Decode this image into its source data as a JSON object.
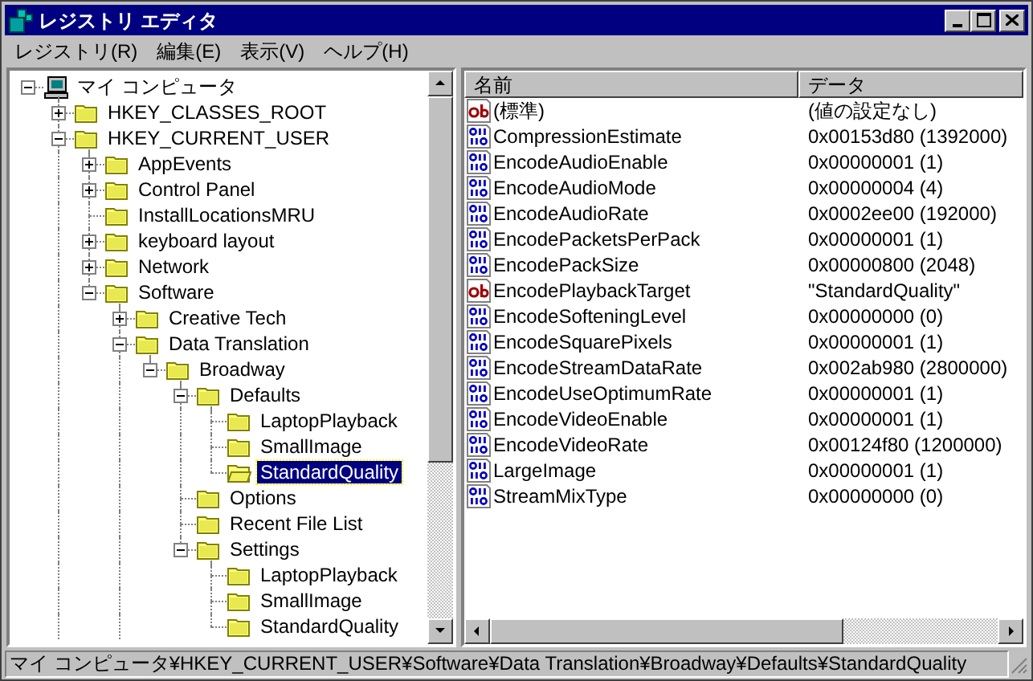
{
  "window": {
    "title": "レジストリ エディタ"
  },
  "menu": [
    "レジストリ(R)",
    "編集(E)",
    "表示(V)",
    "ヘルプ(H)"
  ],
  "tree": {
    "label": "マイ コンピュータ",
    "kind": "computer",
    "expanded": true,
    "selected": false,
    "children": [
      {
        "label": "HKEY_CLASSES_ROOT",
        "expanded": false,
        "selected": false
      },
      {
        "label": "HKEY_CURRENT_USER",
        "expanded": true,
        "selected": false,
        "continues": true,
        "children": [
          {
            "label": "AppEvents",
            "expanded": false,
            "selected": false
          },
          {
            "label": "Control Panel",
            "expanded": false,
            "selected": false
          },
          {
            "label": "InstallLocationsMRU",
            "selected": false
          },
          {
            "label": "keyboard layout",
            "expanded": false,
            "selected": false
          },
          {
            "label": "Network",
            "expanded": false,
            "selected": false
          },
          {
            "label": "Software",
            "expanded": true,
            "selected": false,
            "children": [
              {
                "label": "Creative Tech",
                "expanded": false,
                "selected": false
              },
              {
                "label": "Data Translation",
                "expanded": true,
                "selected": false,
                "continues": true,
                "children": [
                  {
                    "label": "Broadway",
                    "expanded": true,
                    "selected": false,
                    "children": [
                      {
                        "label": "Defaults",
                        "expanded": true,
                        "selected": false,
                        "children": [
                          {
                            "label": "LaptopPlayback",
                            "selected": false
                          },
                          {
                            "label": "SmallImage",
                            "selected": false
                          },
                          {
                            "label": "StandardQuality",
                            "selected": true
                          }
                        ]
                      },
                      {
                        "label": "Options",
                        "selected": false
                      },
                      {
                        "label": "Recent File List",
                        "selected": false
                      },
                      {
                        "label": "Settings",
                        "expanded": true,
                        "selected": false,
                        "children": [
                          {
                            "label": "LaptopPlayback",
                            "selected": false
                          },
                          {
                            "label": "SmallImage",
                            "selected": false
                          },
                          {
                            "label": "StandardQuality",
                            "selected": false
                          }
                        ]
                      }
                    ]
                  }
                ]
              }
            ]
          }
        ]
      }
    ]
  },
  "list": {
    "columns": [
      "名前",
      "データ"
    ],
    "rows": [
      {
        "kind": "string",
        "name": "(標準)",
        "data": "(値の設定なし)"
      },
      {
        "kind": "dword",
        "name": "CompressionEstimate",
        "data": "0x00153d80 (1392000)"
      },
      {
        "kind": "dword",
        "name": "EncodeAudioEnable",
        "data": "0x00000001 (1)"
      },
      {
        "kind": "dword",
        "name": "EncodeAudioMode",
        "data": "0x00000004 (4)"
      },
      {
        "kind": "dword",
        "name": "EncodeAudioRate",
        "data": "0x0002ee00 (192000)"
      },
      {
        "kind": "dword",
        "name": "EncodePacketsPerPack",
        "data": "0x00000001 (1)"
      },
      {
        "kind": "dword",
        "name": "EncodePackSize",
        "data": "0x00000800 (2048)"
      },
      {
        "kind": "string",
        "name": "EncodePlaybackTarget",
        "data": "\"StandardQuality\""
      },
      {
        "kind": "dword",
        "name": "EncodeSofteningLevel",
        "data": "0x00000000 (0)"
      },
      {
        "kind": "dword",
        "name": "EncodeSquarePixels",
        "data": "0x00000001 (1)"
      },
      {
        "kind": "dword",
        "name": "EncodeStreamDataRate",
        "data": "0x002ab980 (2800000)"
      },
      {
        "kind": "dword",
        "name": "EncodeUseOptimumRate",
        "data": "0x00000001 (1)"
      },
      {
        "kind": "dword",
        "name": "EncodeVideoEnable",
        "data": "0x00000001 (1)"
      },
      {
        "kind": "dword",
        "name": "EncodeVideoRate",
        "data": "0x00124f80 (1200000)"
      },
      {
        "kind": "dword",
        "name": "LargeImage",
        "data": "0x00000001 (1)"
      },
      {
        "kind": "dword",
        "name": "StreamMixType",
        "data": "0x00000000 (0)"
      }
    ]
  },
  "status_bar": "マイ コンピュータ¥HKEY_CURRENT_USER¥Software¥Data Translation¥Broadway¥Defaults¥StandardQuality"
}
